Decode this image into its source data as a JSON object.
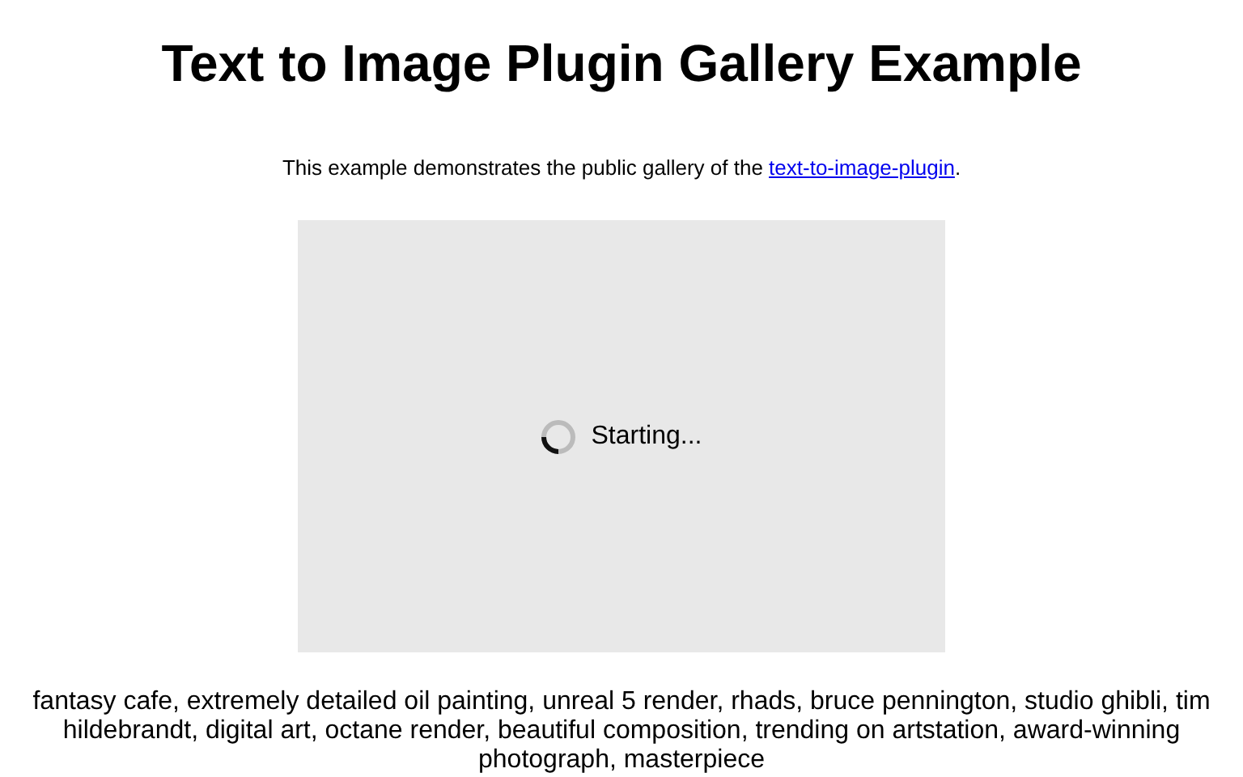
{
  "title": "Text to Image Plugin Gallery Example",
  "intro": {
    "text": "This example demonstrates the public gallery of the ",
    "link": "text-to-image-plugin",
    "after": "."
  },
  "gallery": {
    "status": "Starting..."
  },
  "caption": "fantasy cafe, extremely detailed oil painting, unreal 5 render, rhads, bruce pennington, studio ghibli, tim hildebrandt, digital art, octane render, beautiful composition, trending on artstation, award-winning photograph, masterpiece"
}
